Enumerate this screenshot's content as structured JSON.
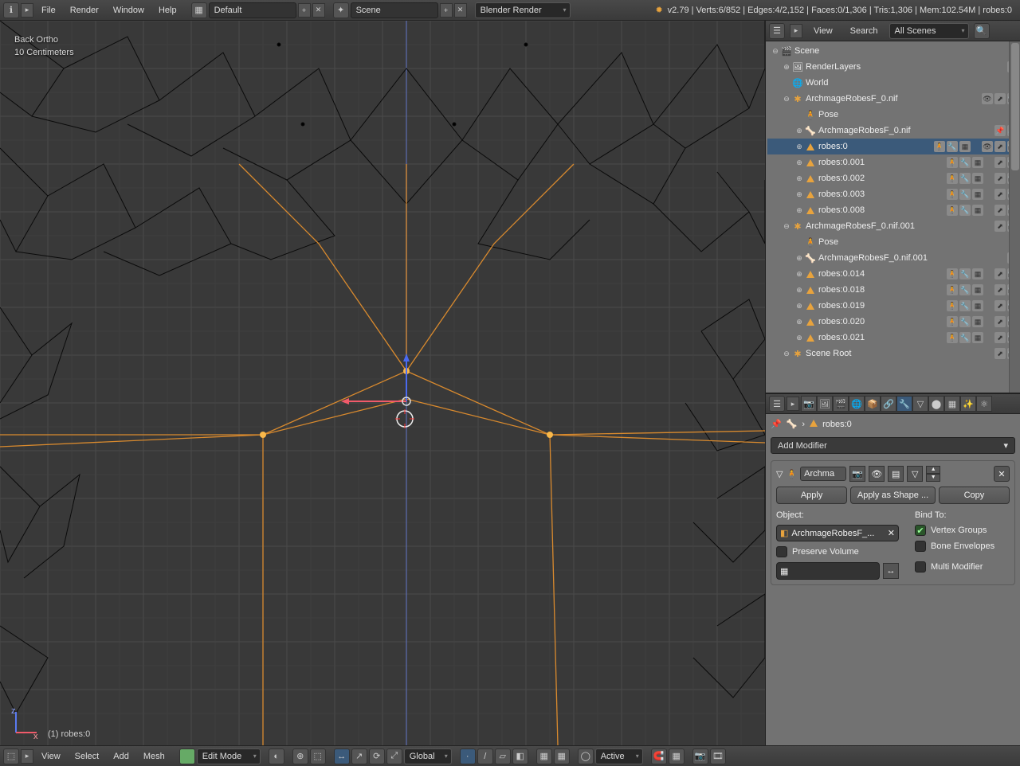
{
  "topbar": {
    "menus": [
      "File",
      "Render",
      "Window",
      "Help"
    ],
    "layout": "Default",
    "scene": "Scene",
    "engine": "Blender Render",
    "stats": "v2.79 | Verts:6/852 | Edges:4/2,152 | Faces:0/1,306 | Tris:1,306 | Mem:102.54M | robes:0"
  },
  "viewport": {
    "view_name": "Back Ortho",
    "grid_scale": "10 Centimeters",
    "object_label": "(1) robes:0"
  },
  "bottombar": {
    "menus": [
      "View",
      "Select",
      "Add",
      "Mesh"
    ],
    "mode": "Edit Mode",
    "orientation": "Global",
    "overlap": "Active"
  },
  "outliner": {
    "header": {
      "view": "View",
      "search": "Search",
      "filter": "All Scenes"
    },
    "tree": {
      "scene": "Scene",
      "renderlayers": "RenderLayers",
      "world": "World",
      "arm0": "ArchmageRobesF_0.nif",
      "pose": "Pose",
      "arm0b": "ArchmageRobesF_0.nif",
      "robes0": "robes:0",
      "robes001": "robes:0.001",
      "robes002": "robes:0.002",
      "robes003": "robes:0.003",
      "robes008": "robes:0.008",
      "arm1": "ArchmageRobesF_0.nif.001",
      "arm1b": "ArchmageRobesF_0.nif.001",
      "robes014": "robes:0.014",
      "robes018": "robes:0.018",
      "robes019": "robes:0.019",
      "robes020": "robes:0.020",
      "robes021": "robes:0.021",
      "sceneroot": "Scene Root"
    }
  },
  "properties": {
    "breadcrumb_obj": "robes:0",
    "add_modifier": "Add Modifier",
    "modifier": {
      "name": "Archma",
      "apply": "Apply",
      "apply_shape": "Apply as Shape ...",
      "copy": "Copy",
      "object_label": "Object:",
      "object_value": "ArchmageRobesF_...",
      "preserve_volume": "Preserve Volume",
      "bind_to": "Bind To:",
      "vertex_groups": "Vertex Groups",
      "bone_envelopes": "Bone Envelopes",
      "multi_modifier": "Multi Modifier"
    }
  }
}
